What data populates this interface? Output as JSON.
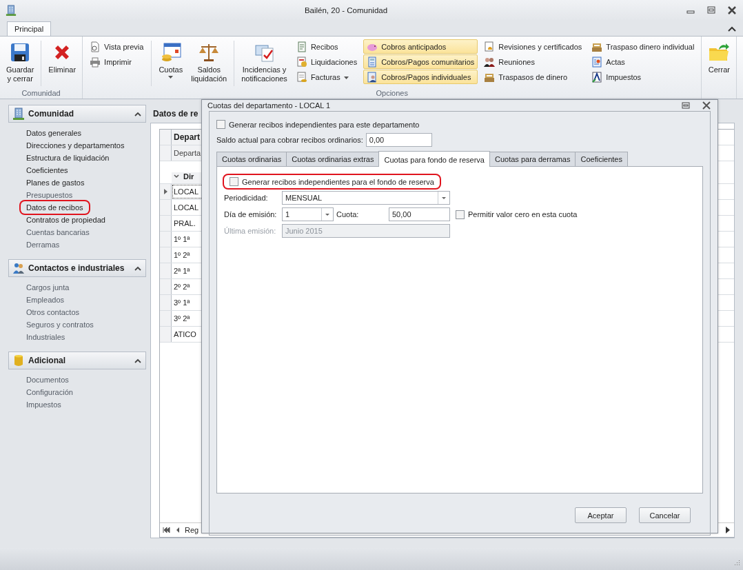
{
  "window": {
    "title": "Bailén, 20 - Comunidad"
  },
  "ribbon": {
    "tabs": [
      {
        "label": "Principal",
        "selected": true
      }
    ],
    "groups": [
      {
        "label": "Comunidad",
        "items": [
          {
            "kind": "large",
            "label": "Guardar\ny cerrar",
            "dropdown": false
          },
          {
            "kind": "separator"
          },
          {
            "kind": "large",
            "label": "Eliminar",
            "dropdown": false
          }
        ]
      },
      {
        "label": "Opciones",
        "items": [
          {
            "kind": "stack",
            "buttons": [
              {
                "label": "Vista previa",
                "dropdown": false,
                "highlighted": false
              },
              {
                "label": "Imprimir",
                "dropdown": false,
                "highlighted": false
              }
            ]
          },
          {
            "kind": "separator"
          },
          {
            "kind": "large",
            "label": "Cuotas",
            "dropdown": true
          },
          {
            "kind": "large",
            "label": "Saldos\nliquidación",
            "dropdown": false
          },
          {
            "kind": "separator"
          },
          {
            "kind": "large",
            "label": "Incidencias y\nnotificaciones",
            "dropdown": false
          },
          {
            "kind": "stack",
            "buttons": [
              {
                "label": "Recibos",
                "dropdown": false,
                "highlighted": false
              },
              {
                "label": "Liquidaciones",
                "dropdown": false,
                "highlighted": false
              },
              {
                "label": "Facturas",
                "dropdown": true,
                "highlighted": false
              }
            ]
          },
          {
            "kind": "stack",
            "buttons": [
              {
                "label": "Cobros anticipados",
                "dropdown": false,
                "highlighted": true
              },
              {
                "label": "Cobros/Pagos comunitarios",
                "dropdown": false,
                "highlighted": true
              },
              {
                "label": "Cobros/Pagos individuales",
                "dropdown": false,
                "highlighted": true
              }
            ]
          },
          {
            "kind": "stack",
            "buttons": [
              {
                "label": "Revisiones y certificados",
                "dropdown": false,
                "highlighted": false
              },
              {
                "label": "Reuniones",
                "dropdown": false,
                "highlighted": false
              },
              {
                "label": "Traspasos de dinero",
                "dropdown": false,
                "highlighted": false
              }
            ]
          },
          {
            "kind": "stack",
            "buttons": [
              {
                "label": "Traspaso dinero individual",
                "dropdown": false,
                "highlighted": false
              },
              {
                "label": "Actas",
                "dropdown": false,
                "highlighted": false
              },
              {
                "label": "Impuestos",
                "dropdown": false,
                "highlighted": false
              }
            ]
          }
        ]
      },
      {
        "items": [
          {
            "kind": "large",
            "label": "Cerrar",
            "dropdown": false
          }
        ]
      }
    ]
  },
  "sidebar": {
    "sections": [
      {
        "title": "Comunidad",
        "expanded": true,
        "items": [
          {
            "label": "Datos generales",
            "dimmed": false,
            "circled": false
          },
          {
            "label": "Direcciones y departamentos",
            "dimmed": false,
            "circled": false
          },
          {
            "label": "Estructura de liquidación",
            "dimmed": false,
            "circled": false
          },
          {
            "label": "Coeficientes",
            "dimmed": false,
            "circled": false
          },
          {
            "label": "Planes de gastos",
            "dimmed": false,
            "circled": false
          },
          {
            "label": "Presupuestos",
            "dimmed": true,
            "circled": false
          },
          {
            "label": "Datos de recibos",
            "dimmed": false,
            "circled": true
          },
          {
            "label": "Contratos de propiedad",
            "dimmed": false,
            "circled": false
          },
          {
            "label": "Cuentas bancarias",
            "dimmed": true,
            "circled": false
          },
          {
            "label": "Derramas",
            "dimmed": true,
            "circled": false
          }
        ]
      },
      {
        "title": "Contactos e industriales",
        "expanded": true,
        "items": [
          {
            "label": "Cargos junta",
            "dimmed": true,
            "circled": false
          },
          {
            "label": "Empleados",
            "dimmed": true,
            "circled": false
          },
          {
            "label": "Otros contactos",
            "dimmed": true,
            "circled": false
          },
          {
            "label": "Seguros y contratos",
            "dimmed": true,
            "circled": false
          },
          {
            "label": "Industriales",
            "dimmed": true,
            "circled": false
          }
        ]
      },
      {
        "title": "Adicional",
        "expanded": true,
        "items": [
          {
            "label": "Documentos",
            "dimmed": true,
            "circled": false
          },
          {
            "label": "Configuración",
            "dimmed": true,
            "circled": false
          },
          {
            "label": "Impuestos",
            "dimmed": true,
            "circled": false
          }
        ]
      }
    ]
  },
  "main": {
    "header": "Datos de re",
    "grid": {
      "column_header": "Depart",
      "subheader": "Departa",
      "group_header": "Dir",
      "rows": [
        {
          "cell": "LOCAL",
          "selected": true
        },
        {
          "cell": "LOCAL",
          "selected": false
        },
        {
          "cell": "PRAL.",
          "selected": false
        },
        {
          "cell": "1º 1ª",
          "selected": false
        },
        {
          "cell": "1º 2ª",
          "selected": false
        },
        {
          "cell": "2ª 1ª",
          "selected": false
        },
        {
          "cell": "2º 2ª",
          "selected": false
        },
        {
          "cell": "3º 1ª",
          "selected": false
        },
        {
          "cell": "3º 2ª",
          "selected": false
        },
        {
          "cell": "ATICO",
          "selected": false
        }
      ],
      "footer": "Reg"
    }
  },
  "dialog": {
    "title": "Cuotas del departamento - LOCAL 1",
    "checkbox": {
      "label": "Generar recibos independientes para este departamento",
      "checked": false
    },
    "balance": {
      "label": "Saldo actual para cobrar recibos ordinarios:",
      "value": "0,00"
    },
    "tabs": [
      {
        "label": "Cuotas ordinarias",
        "selected": false
      },
      {
        "label": "Cuotas ordinarias extras",
        "selected": false
      },
      {
        "label": "Cuotas para fondo de reserva",
        "selected": true
      },
      {
        "label": "Cuotas para derramas",
        "selected": false
      },
      {
        "label": "Coeficientes",
        "selected": false
      }
    ],
    "panel": {
      "reserve_checkbox": {
        "label": "Generar recibos independientes para el fondo de reserva",
        "checked": false,
        "circled": true
      },
      "periodicity": {
        "label": "Periodicidad:",
        "value": "MENSUAL"
      },
      "issue_day": {
        "label": "Día de emisión:",
        "value": "1"
      },
      "fee": {
        "label": "Cuota:",
        "value": "50,00"
      },
      "zero_checkbox": {
        "label": "Permitir valor cero en esta cuota",
        "checked": false
      },
      "last_issue": {
        "label": "Última emisión:",
        "value": "Junio 2015",
        "disabled": true
      }
    },
    "buttons": [
      "Aceptar",
      "Cancelar"
    ]
  }
}
